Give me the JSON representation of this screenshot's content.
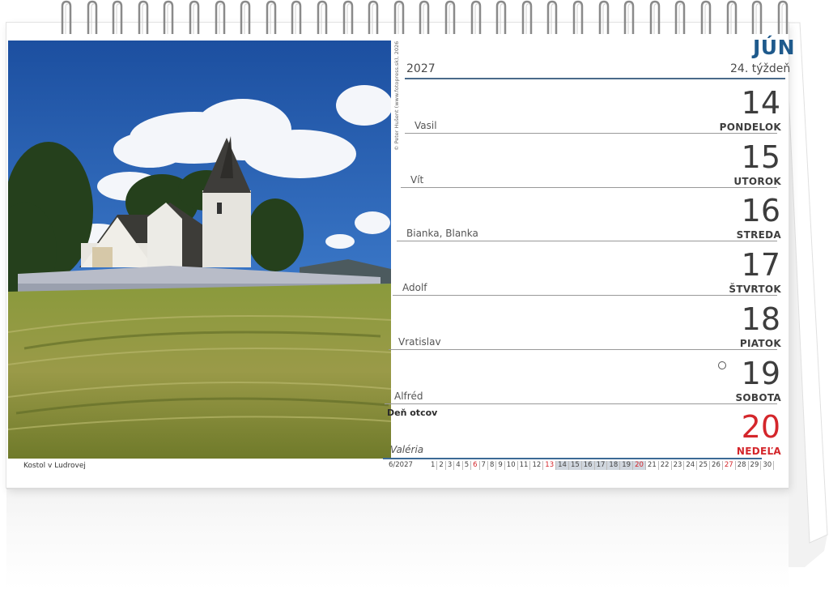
{
  "calendar": {
    "month": "JÚN",
    "year": "2027",
    "week": "24. týždeň",
    "photo_caption": "Kostol v Ludrovej",
    "photo_credit": "© Peter Hušent (www.fotopress.sk), 2026",
    "days": [
      {
        "number": "14",
        "name": "PONDELOK",
        "nameday": "Vasil"
      },
      {
        "number": "15",
        "name": "UTOROK",
        "nameday": "Vít"
      },
      {
        "number": "16",
        "name": "STREDA",
        "nameday": "Bianka, Blanka"
      },
      {
        "number": "17",
        "name": "ŠTVRTOK",
        "nameday": "Adolf"
      },
      {
        "number": "18",
        "name": "PIATOK",
        "nameday": "Vratislav"
      },
      {
        "number": "19",
        "name": "SOBOTA",
        "nameday": "Alfréd"
      },
      {
        "number": "20",
        "name": "NEDEĽA",
        "nameday": "Valéria"
      }
    ],
    "holiday": "Deň otcov",
    "mini_month": {
      "label": "6/2027",
      "days": [
        "1",
        "2",
        "3",
        "4",
        "5",
        "6",
        "7",
        "8",
        "9",
        "10",
        "11",
        "12",
        "13",
        "14",
        "15",
        "16",
        "17",
        "18",
        "19",
        "20",
        "21",
        "22",
        "23",
        "24",
        "25",
        "26",
        "27",
        "28",
        "29",
        "30"
      ],
      "red_days": [
        "6",
        "13",
        "20",
        "27"
      ],
      "highlight_days": [
        "14",
        "15",
        "16",
        "17",
        "18",
        "19",
        "20"
      ]
    },
    "colors": {
      "accent_blue": "#1f5a8c",
      "sunday_red": "#d4262b",
      "text": "#3d3d3d"
    }
  }
}
